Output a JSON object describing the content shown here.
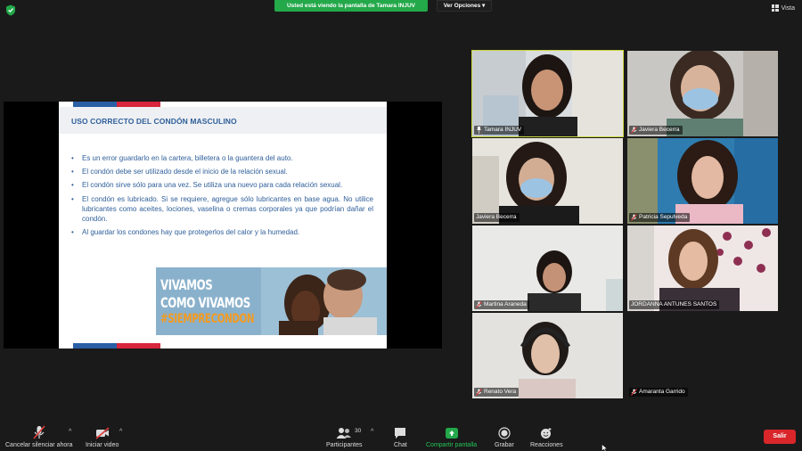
{
  "top_bar": {
    "share_banner": "Usted está viendo la pantalla de Tamara INJUV",
    "view_options": "Ver Opciones",
    "view_options_caret": "▾",
    "vista_label": "Vista"
  },
  "slide": {
    "title": "USO CORRECTO DEL CONDÓN MASCULINO",
    "bullets": [
      "Es un error guardarlo en la cartera, billetera o la guantera del auto.",
      "El condón debe ser utilizado desde el inicio de la relación sexual.",
      "El condón sirve sólo para una vez. Se utiliza una nuevo para cada relación sexual.",
      "El condón es lubricado. Si se requiere, agregue sólo lubricantes en base agua. No utilice lubricantes como aceites, lociones, vaselina o cremas corporales ya que podrían dañar el condón.",
      "Al guardar los condones hay que protegerlos del calor y la humedad."
    ],
    "banner": {
      "line1": "VIVAMOS",
      "line2": "COMO VIVAMOS",
      "line3": "#SIEMPRECONDON"
    }
  },
  "participants": [
    {
      "name": "Tamara INJUV",
      "icon": "pin-icon"
    },
    {
      "name": "Javiera Becerra",
      "icon": "mic-muted-icon"
    },
    {
      "name": "Javiera Becerra",
      "icon": "none"
    },
    {
      "name": "Patricia Sepulveda",
      "icon": "mic-muted-icon"
    },
    {
      "name": "Martina Araneda",
      "icon": "mic-muted-icon"
    },
    {
      "name": "JORDANNA ANTUNES SANTOS",
      "icon": "none"
    },
    {
      "name": "Renato Vera",
      "icon": "mic-muted-icon"
    },
    {
      "name": "Amaranta Garrido",
      "icon": "mic-muted-icon"
    }
  ],
  "toolbar": {
    "mute": "Cancelar silenciar ahora",
    "video": "Iniciar video",
    "participants": "Participantes",
    "participants_count": "30",
    "chat": "Chat",
    "share": "Compartir pantalla",
    "record": "Grabar",
    "reactions": "Reacciones",
    "leave": "Salir",
    "caret": "^"
  },
  "colors": {
    "share_green": "#23a84a",
    "leave_red": "#d9262b",
    "slide_blue": "#2f5f9a",
    "banner_orange": "#f39a1f",
    "active_speaker": "#c9d53a"
  }
}
